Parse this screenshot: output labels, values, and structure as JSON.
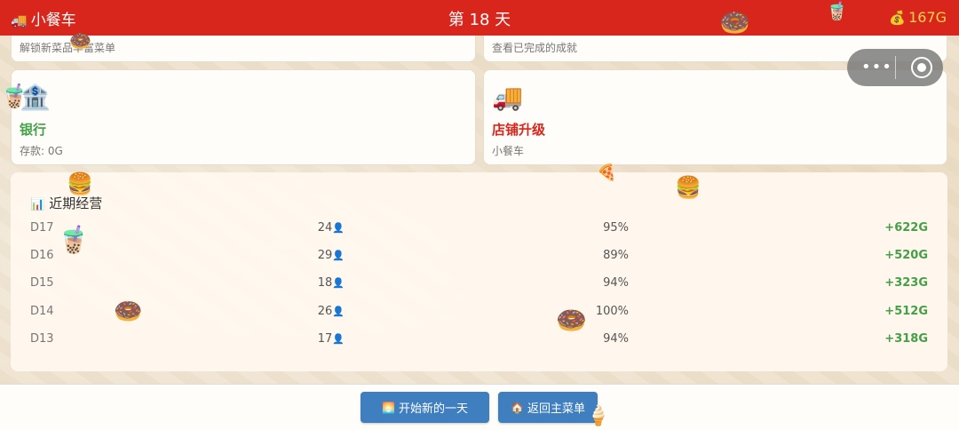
{
  "topbar": {
    "truck_icon": "🚚",
    "app_title": "小餐车",
    "day_title": "第 18 天",
    "gold_icon": "💰",
    "gold": "167G"
  },
  "cards": {
    "menu_desc": "解锁新菜品丰富菜单",
    "achievement_desc": "查看已完成的成就",
    "bank": {
      "icon": "🏦",
      "name": "银行",
      "desc": "存款: 0G",
      "color": "#43a047"
    },
    "shop": {
      "icon": "🚚",
      "name": "店铺升级",
      "desc": "小餐车",
      "color": "#d9261c"
    }
  },
  "recent": {
    "icon": "📊",
    "title": "近期经营",
    "person_icon": "👤",
    "rows": [
      {
        "day": "D17",
        "customers": "24",
        "rate": "95%",
        "profit": "+622G"
      },
      {
        "day": "D16",
        "customers": "29",
        "rate": "89%",
        "profit": "+520G"
      },
      {
        "day": "D15",
        "customers": "18",
        "rate": "94%",
        "profit": "+323G"
      },
      {
        "day": "D14",
        "customers": "26",
        "rate": "100%",
        "profit": "+512G"
      },
      {
        "day": "D13",
        "customers": "17",
        "rate": "94%",
        "profit": "+318G"
      }
    ]
  },
  "buttons": {
    "new_day_icon": "🌅",
    "new_day": "开始新的一天",
    "home_icon": "🏠",
    "home": "返回主菜单"
  },
  "capsule": {
    "more_icon": "•••",
    "close_icon": "target-icon"
  },
  "decorations": {
    "donut": "🍩",
    "bubble_tea": "🧋",
    "burger": "🍔",
    "pizza": "🍕",
    "ice_cream": "🍦"
  },
  "colors": {
    "topbar": "#d9261c",
    "gold": "#ffd24d",
    "profit": "#43a047",
    "button": "#3f7fbf"
  }
}
